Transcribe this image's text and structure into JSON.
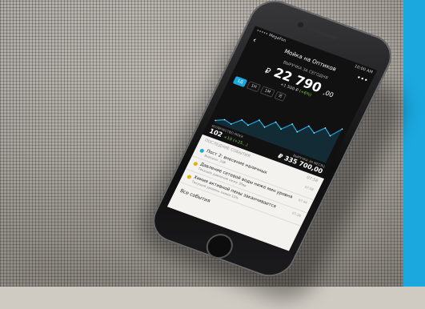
{
  "status_bar": {
    "carrier": "••••• MegaFon",
    "time": "10:00 AM"
  },
  "header": {
    "title": "Мойка на Оптиков",
    "subtitle": "ВЫРУЧКА ЗА СЕГОДНЯ",
    "currency": "₽",
    "amount": "22 790",
    "amount_cents": ",00",
    "delta": "+1 500 ₽",
    "delta_pct": "(+6%)"
  },
  "tabs": [
    {
      "label": "1Д",
      "active": true
    },
    {
      "label": "1Н",
      "active": false
    },
    {
      "label": "1М",
      "active": false
    },
    {
      "label": "☰",
      "active": false
    }
  ],
  "chart_data": {
    "type": "line",
    "values": [
      10,
      14,
      12,
      20,
      17,
      26,
      21,
      30,
      25,
      34,
      28,
      38,
      33,
      42,
      36,
      47
    ]
  },
  "stats": {
    "left_label": "КОЛИЧЕСТВО МОЕК",
    "left_value": "102",
    "left_extra": "+10 (+25…)",
    "right_label": "ВЫРУЧКА ЗА МЕСЯЦ",
    "right_value": "₽ 335 700,00"
  },
  "events": {
    "header": "ПОСЛЕДНИЕ СОБЫТИЯ",
    "header_time": "07:58",
    "items": [
      {
        "title": "Пост 2: внесение наличных",
        "sub": "Внесено: 20₽",
        "time": "07:58",
        "color": "#1aa8df"
      },
      {
        "title": "Давление сетевой воды ниже мин уровня",
        "sub": "Текущее давление ниже 3бар",
        "time": "07:44",
        "color": "#e0b21a"
      },
      {
        "title": "Химия активной пены заканчивается",
        "sub": "Текущий уровень химии 10%",
        "time": "07:26",
        "color": "#e0b21a"
      }
    ],
    "all_label": "Все события"
  },
  "colors": {
    "accent": "#1aa8df",
    "positive": "#7bd23c",
    "warning": "#e0b21a"
  }
}
